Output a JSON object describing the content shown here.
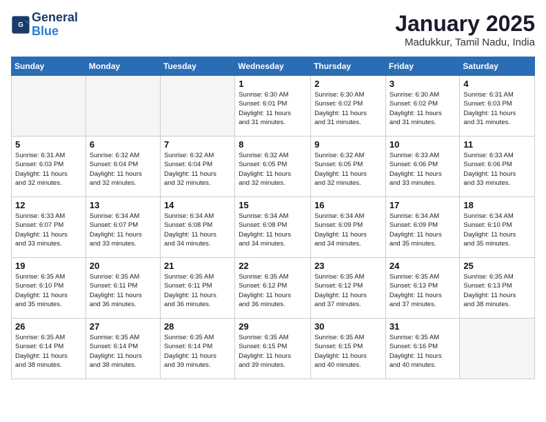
{
  "logo": {
    "line1": "General",
    "line2": "Blue"
  },
  "title": "January 2025",
  "subtitle": "Madukkur, Tamil Nadu, India",
  "headers": [
    "Sunday",
    "Monday",
    "Tuesday",
    "Wednesday",
    "Thursday",
    "Friday",
    "Saturday"
  ],
  "weeks": [
    [
      {
        "day": "",
        "info": ""
      },
      {
        "day": "",
        "info": ""
      },
      {
        "day": "",
        "info": ""
      },
      {
        "day": "1",
        "info": "Sunrise: 6:30 AM\nSunset: 6:01 PM\nDaylight: 11 hours\nand 31 minutes."
      },
      {
        "day": "2",
        "info": "Sunrise: 6:30 AM\nSunset: 6:02 PM\nDaylight: 11 hours\nand 31 minutes."
      },
      {
        "day": "3",
        "info": "Sunrise: 6:30 AM\nSunset: 6:02 PM\nDaylight: 11 hours\nand 31 minutes."
      },
      {
        "day": "4",
        "info": "Sunrise: 6:31 AM\nSunset: 6:03 PM\nDaylight: 11 hours\nand 31 minutes."
      }
    ],
    [
      {
        "day": "5",
        "info": "Sunrise: 6:31 AM\nSunset: 6:03 PM\nDaylight: 11 hours\nand 32 minutes."
      },
      {
        "day": "6",
        "info": "Sunrise: 6:32 AM\nSunset: 6:04 PM\nDaylight: 11 hours\nand 32 minutes."
      },
      {
        "day": "7",
        "info": "Sunrise: 6:32 AM\nSunset: 6:04 PM\nDaylight: 11 hours\nand 32 minutes."
      },
      {
        "day": "8",
        "info": "Sunrise: 6:32 AM\nSunset: 6:05 PM\nDaylight: 11 hours\nand 32 minutes."
      },
      {
        "day": "9",
        "info": "Sunrise: 6:32 AM\nSunset: 6:05 PM\nDaylight: 11 hours\nand 32 minutes."
      },
      {
        "day": "10",
        "info": "Sunrise: 6:33 AM\nSunset: 6:06 PM\nDaylight: 11 hours\nand 33 minutes."
      },
      {
        "day": "11",
        "info": "Sunrise: 6:33 AM\nSunset: 6:06 PM\nDaylight: 11 hours\nand 33 minutes."
      }
    ],
    [
      {
        "day": "12",
        "info": "Sunrise: 6:33 AM\nSunset: 6:07 PM\nDaylight: 11 hours\nand 33 minutes."
      },
      {
        "day": "13",
        "info": "Sunrise: 6:34 AM\nSunset: 6:07 PM\nDaylight: 11 hours\nand 33 minutes."
      },
      {
        "day": "14",
        "info": "Sunrise: 6:34 AM\nSunset: 6:08 PM\nDaylight: 11 hours\nand 34 minutes."
      },
      {
        "day": "15",
        "info": "Sunrise: 6:34 AM\nSunset: 6:08 PM\nDaylight: 11 hours\nand 34 minutes."
      },
      {
        "day": "16",
        "info": "Sunrise: 6:34 AM\nSunset: 6:09 PM\nDaylight: 11 hours\nand 34 minutes."
      },
      {
        "day": "17",
        "info": "Sunrise: 6:34 AM\nSunset: 6:09 PM\nDaylight: 11 hours\nand 35 minutes."
      },
      {
        "day": "18",
        "info": "Sunrise: 6:34 AM\nSunset: 6:10 PM\nDaylight: 11 hours\nand 35 minutes."
      }
    ],
    [
      {
        "day": "19",
        "info": "Sunrise: 6:35 AM\nSunset: 6:10 PM\nDaylight: 11 hours\nand 35 minutes."
      },
      {
        "day": "20",
        "info": "Sunrise: 6:35 AM\nSunset: 6:11 PM\nDaylight: 11 hours\nand 36 minutes."
      },
      {
        "day": "21",
        "info": "Sunrise: 6:35 AM\nSunset: 6:11 PM\nDaylight: 11 hours\nand 36 minutes."
      },
      {
        "day": "22",
        "info": "Sunrise: 6:35 AM\nSunset: 6:12 PM\nDaylight: 11 hours\nand 36 minutes."
      },
      {
        "day": "23",
        "info": "Sunrise: 6:35 AM\nSunset: 6:12 PM\nDaylight: 11 hours\nand 37 minutes."
      },
      {
        "day": "24",
        "info": "Sunrise: 6:35 AM\nSunset: 6:13 PM\nDaylight: 11 hours\nand 37 minutes."
      },
      {
        "day": "25",
        "info": "Sunrise: 6:35 AM\nSunset: 6:13 PM\nDaylight: 11 hours\nand 38 minutes."
      }
    ],
    [
      {
        "day": "26",
        "info": "Sunrise: 6:35 AM\nSunset: 6:14 PM\nDaylight: 11 hours\nand 38 minutes."
      },
      {
        "day": "27",
        "info": "Sunrise: 6:35 AM\nSunset: 6:14 PM\nDaylight: 11 hours\nand 38 minutes."
      },
      {
        "day": "28",
        "info": "Sunrise: 6:35 AM\nSunset: 6:14 PM\nDaylight: 11 hours\nand 39 minutes."
      },
      {
        "day": "29",
        "info": "Sunrise: 6:35 AM\nSunset: 6:15 PM\nDaylight: 11 hours\nand 39 minutes."
      },
      {
        "day": "30",
        "info": "Sunrise: 6:35 AM\nSunset: 6:15 PM\nDaylight: 11 hours\nand 40 minutes."
      },
      {
        "day": "31",
        "info": "Sunrise: 6:35 AM\nSunset: 6:16 PM\nDaylight: 11 hours\nand 40 minutes."
      },
      {
        "day": "",
        "info": ""
      }
    ]
  ]
}
